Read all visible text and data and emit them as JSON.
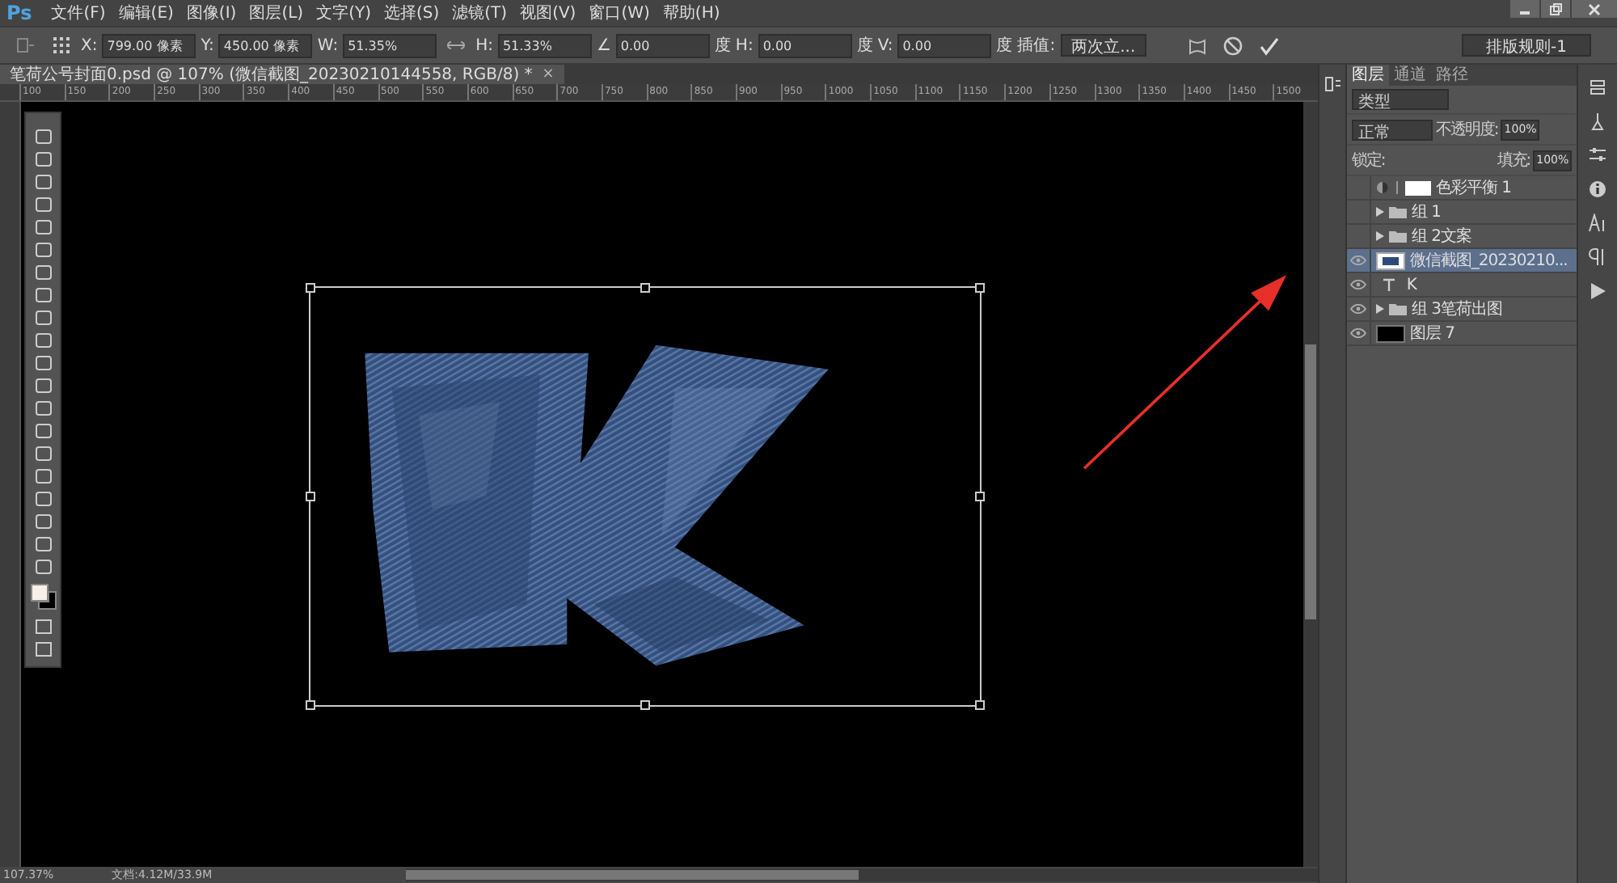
{
  "app": {
    "logo": "Ps"
  },
  "menu": [
    "文件(F)",
    "编辑(E)",
    "图像(I)",
    "图层(L)",
    "文字(Y)",
    "选择(S)",
    "滤镜(T)",
    "视图(V)",
    "窗口(W)",
    "帮助(H)"
  ],
  "options": [
    {
      "label": "X:",
      "value": "799.00 像素"
    },
    {
      "label": "Y:",
      "value": "450.00 像素"
    },
    {
      "label": "W:",
      "value": "51.35%"
    },
    {
      "label": "H:",
      "value": "51.33%"
    },
    {
      "label": "∠",
      "value": "0.00",
      "unit": "度"
    },
    {
      "label": "H:",
      "value": "0.00",
      "unit": "度"
    },
    {
      "label": "V:",
      "value": "0.00",
      "unit": "度"
    }
  ],
  "interpolation": {
    "label": "插值:",
    "value": "两次立..."
  },
  "workspace": "排版规则-1",
  "document_tab": {
    "title": "笔荷公号封面0.psd @ 107% (微信截图_20230210144558, RGB/8) *",
    "close": "×"
  },
  "ruler": [
    "100",
    "150",
    "200",
    "250",
    "300",
    "350",
    "400",
    "450",
    "500",
    "550",
    "600",
    "650",
    "700",
    "750",
    "800",
    "850",
    "900",
    "950",
    "1000",
    "1050",
    "1100",
    "1150",
    "1200",
    "1250",
    "1300",
    "1350",
    "1400",
    "1450",
    "1500"
  ],
  "layers_panel": {
    "tabs": [
      {
        "label": "图层",
        "selected": true
      },
      {
        "label": "通道",
        "selected": false
      },
      {
        "label": "路径",
        "selected": false
      }
    ],
    "filter": "类型",
    "blend_mode": "正常",
    "opacity_label": "不透明度:",
    "opacity": "100%",
    "lock_label": "锁定:",
    "fill_label": "填充:",
    "fill": "100%",
    "layers": [
      {
        "kind": "adjustment",
        "name": "色彩平衡 1",
        "visible": false,
        "selected": false
      },
      {
        "kind": "group",
        "name": "组 1",
        "visible": false,
        "selected": false
      },
      {
        "kind": "group",
        "name": "组 2文案",
        "visible": false,
        "selected": false
      },
      {
        "kind": "smart",
        "name": "微信截图_20230210...",
        "visible": true,
        "selected": true
      },
      {
        "kind": "text",
        "name": "K",
        "visible": true,
        "selected": false
      },
      {
        "kind": "group",
        "name": "组 3笔荷出图",
        "visible": true,
        "selected": false
      },
      {
        "kind": "pixel",
        "name": "图层 7",
        "visible": true,
        "selected": false
      }
    ]
  },
  "status_bar": {
    "zoom": "107.37%",
    "document": "文档:4.12M/33.9M"
  }
}
